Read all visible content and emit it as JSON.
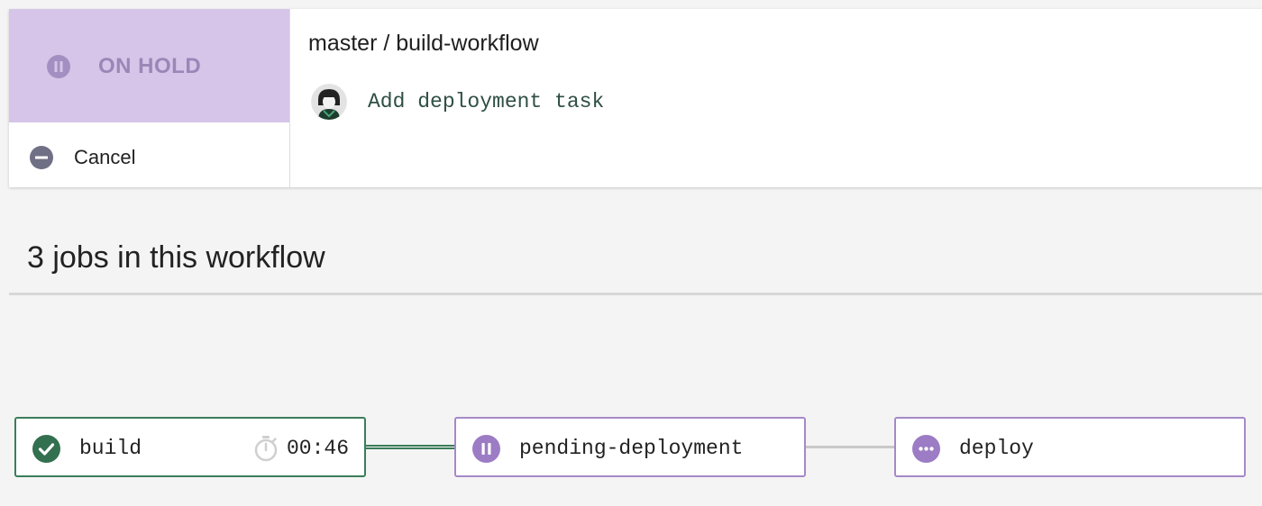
{
  "status": {
    "label": "ON HOLD",
    "icon": "pause-circle-icon",
    "color": "#d6c5e8"
  },
  "actions": {
    "cancel_label": "Cancel"
  },
  "workflow": {
    "branch": "master",
    "separator": "/",
    "name": "build-workflow",
    "title": "master / build-workflow",
    "commit_message": "Add deployment task"
  },
  "jobs_section": {
    "title": "3 jobs in this workflow"
  },
  "jobs": [
    {
      "name": "build",
      "status": "success",
      "icon": "check-circle-icon",
      "duration": "00:46",
      "timer_icon": "stopwatch-icon",
      "color": "#3b7d5a"
    },
    {
      "name": "pending-deployment",
      "status": "on-hold",
      "icon": "pause-circle-icon",
      "color": "#a689c8"
    },
    {
      "name": "deploy",
      "status": "queued",
      "icon": "more-circle-icon",
      "color": "#a689c8"
    }
  ]
}
